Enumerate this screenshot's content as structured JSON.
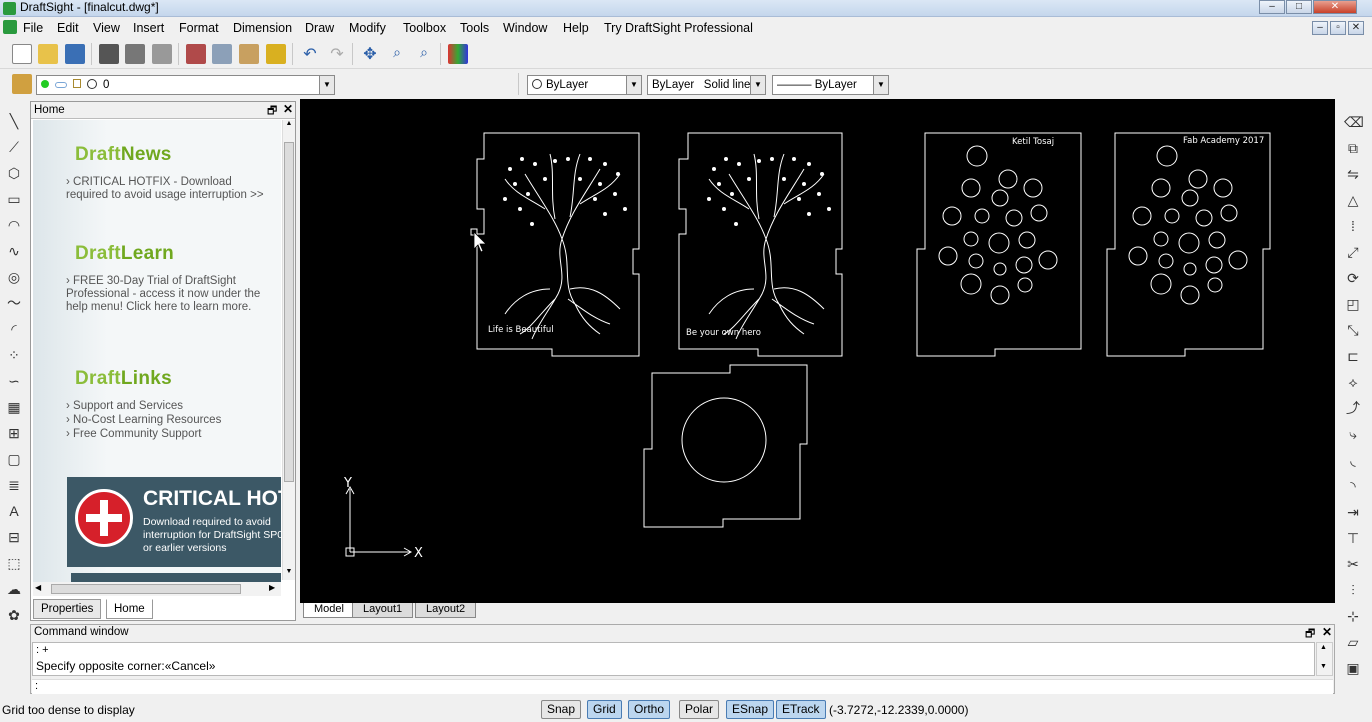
{
  "window": {
    "title": "DraftSight - [finalcut.dwg*]"
  },
  "menu": [
    "File",
    "Edit",
    "View",
    "Insert",
    "Format",
    "Dimension",
    "Draw",
    "Modify",
    "Toolbox",
    "Tools",
    "Window",
    "Help",
    "Try DraftSight Professional"
  ],
  "layer": {
    "value": "0"
  },
  "props": {
    "color": "ByLayer",
    "linetype": "ByLayer",
    "linestyle": "Solid line",
    "lineweight": "——— ByLayer"
  },
  "home": {
    "title": "Home",
    "news": {
      "heading_a": "Draft",
      "heading_b": "News",
      "text": "CRITICAL HOTFIX - Download required to avoid usage interruption >>"
    },
    "learn": {
      "heading_a": "Draft",
      "heading_b": "Learn",
      "text": "FREE 30-Day Trial of DraftSight Professional - access it now under the help menu! Click here to learn more."
    },
    "links": {
      "heading_a": "Draft",
      "heading_b": "Links",
      "items": [
        "Support and Services",
        "No-Cost Learning Resources",
        "Free Community Support"
      ]
    },
    "banner": {
      "title": "CRITICAL HOT",
      "text": "Download required to avoid interruption for DraftSight SP0 or earlier versions"
    },
    "tabs": [
      "Properties",
      "Home"
    ]
  },
  "drawing": {
    "panel1_caption": "Life is Beautiful",
    "panel2_caption": "Be your own hero",
    "panel3_caption": "Ketil Tosaj",
    "panel4_caption": "Fab Academy 2017",
    "axis_x": "X",
    "axis_y": "Y"
  },
  "layouts": [
    "Model",
    "Layout1",
    "Layout2"
  ],
  "command": {
    "title": "Command window",
    "line1": ": +",
    "line2": "Specify opposite corner:«Cancel»",
    "prompt": ":"
  },
  "status": {
    "message": "Grid too dense to display",
    "buttons": [
      {
        "label": "Snap",
        "on": false
      },
      {
        "label": "Grid",
        "on": true
      },
      {
        "label": "Ortho",
        "on": true
      },
      {
        "label": "Polar",
        "on": false
      },
      {
        "label": "ESnap",
        "on": true
      },
      {
        "label": "ETrack",
        "on": true
      }
    ],
    "coords": "(-3.7272,-12.2339,0.0000)"
  }
}
